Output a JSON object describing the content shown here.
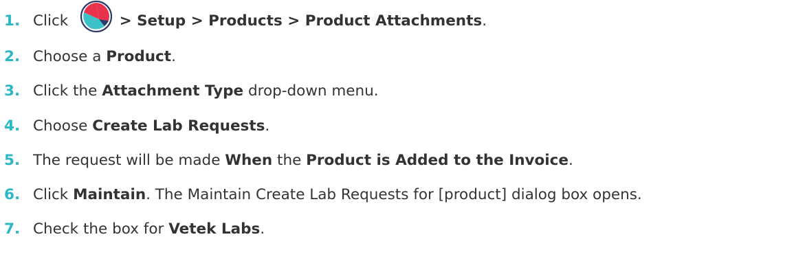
{
  "steps": [
    {
      "number": "1.",
      "parts": [
        {
          "text": "Click "
        },
        {
          "icon": "logo-icon"
        },
        {
          "text": " > Setup > Products > Product Attachments",
          "bold": true
        },
        {
          "text": "."
        }
      ]
    },
    {
      "number": "2.",
      "parts": [
        {
          "text": "Choose a "
        },
        {
          "text": "Product",
          "bold": true
        },
        {
          "text": "."
        }
      ]
    },
    {
      "number": "3.",
      "parts": [
        {
          "text": "Click the "
        },
        {
          "text": "Attachment Type",
          "bold": true
        },
        {
          "text": " drop-down menu."
        }
      ]
    },
    {
      "number": "4.",
      "parts": [
        {
          "text": "Choose "
        },
        {
          "text": "Create Lab Requests",
          "bold": true
        },
        {
          "text": "."
        }
      ]
    },
    {
      "number": "5.",
      "parts": [
        {
          "text": "The request will be made "
        },
        {
          "text": "When",
          "bold": true
        },
        {
          "text": " the "
        },
        {
          "text": "Product is Added to the Invoice",
          "bold": true
        },
        {
          "text": "."
        }
      ]
    },
    {
      "number": "6.",
      "parts": [
        {
          "text": "Click "
        },
        {
          "text": "Maintain",
          "bold": true
        },
        {
          "text": ". The Maintain Create Lab Requests for [product] dialog box opens."
        }
      ]
    },
    {
      "number": "7.",
      "parts": [
        {
          "text": "Check the box for "
        },
        {
          "text": "Vetek Labs",
          "bold": true
        },
        {
          "text": "."
        }
      ]
    }
  ],
  "colors": {
    "step_number": "#2bb8c4",
    "body_text": "#333333",
    "logo_red": "#e8334a",
    "logo_navy": "#2b3a67",
    "logo_teal": "#3cc3c9"
  }
}
